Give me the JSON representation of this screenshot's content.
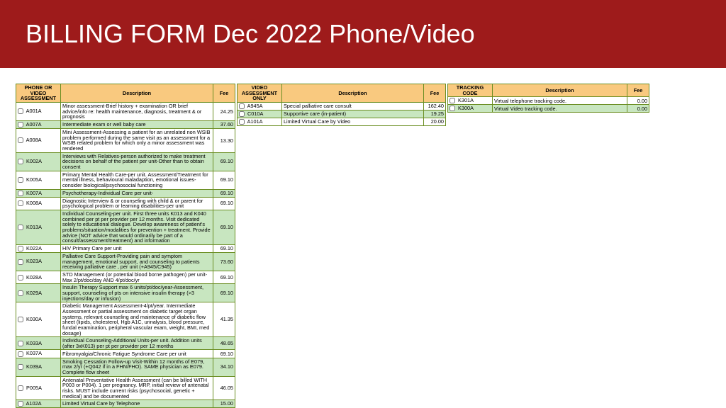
{
  "title": "BILLING FORM Dec 2022 Phone/Video",
  "tables": [
    {
      "headers": [
        "PHONE OR VIDEO ASSESSMENT",
        "Description",
        "Fee"
      ],
      "rows": [
        {
          "code": "A001A",
          "desc": "Minor assessment-Brief history + examination OR brief advice/info re: health maintenance, diagnosis, treatment & or prognosis",
          "fee": "24.25",
          "alt": false
        },
        {
          "code": "A007A",
          "desc": "Intermediate exam or well baby care",
          "fee": "37.60",
          "alt": true
        },
        {
          "code": "A008A",
          "desc": "Mini Assessment-Assessing a patient for an unrelated non WSIB problem performed during the same visit as an assessment for a WSIB related problem for which only a minor assessment was rendered",
          "fee": "13.30",
          "alt": false
        },
        {
          "code": "K002A",
          "desc": "Interviews with Relatives-person authorized to make treatment decisions on behalf of the patient per unit-Other than to obtain consent",
          "fee": "69.10",
          "alt": true
        },
        {
          "code": "K005A",
          "desc": "Primary Mental Health Care-per unit. Assessment/Treatment for mental illness, behavioural maladaption, emotional issues-consider biological/psychosocial functioning",
          "fee": "69.10",
          "alt": false
        },
        {
          "code": "K007A",
          "desc": "Psychotherapy-Individual Care per unit-",
          "fee": "69.10",
          "alt": true
        },
        {
          "code": "K008A",
          "desc": "Diagnostic Interview & or counseling with child & or parent for psychological problem or learning disabilities-per unit",
          "fee": "69.10",
          "alt": false
        },
        {
          "code": "K013A",
          "desc": "Individual Counseling-per unit. First three units K013 and K040 combined per pt per provider per 12 months. Visit dedicated solely to educational dialogue. Develop awareness of patient's problems/situation/modalities for prevention + treatment. Provide advice (NOT advice that would ordinarily be part of a consult/assessment/treatment) and information",
          "fee": "69.10",
          "alt": true
        },
        {
          "code": "K022A",
          "desc": "HIV Primary Care per unit",
          "fee": "69.10",
          "alt": false
        },
        {
          "code": "K023A",
          "desc": "Palliative Care Support-Providing pain and symptom management, emotional support, and counseling to patients receiving palliative care , per unit (+A945/C945)",
          "fee": "73.60",
          "alt": true
        },
        {
          "code": "K028A",
          "desc": "STD Management (or potential blood borne pathogen) per unit-Max 2/pt/doc/day AND 4/pt/doc/yr",
          "fee": "69.10",
          "alt": false
        },
        {
          "code": "K029A",
          "desc": "Insulin Therapy Support max 6 units/pt/doc/year-Assessment, support, counseling of pts on intensive insulin therapy (>3 injections/day or infusion)",
          "fee": "69.10",
          "alt": true
        },
        {
          "code": "K030A",
          "desc": "Diabetic Management Assessment-4/pt/year. Intermediate Assessment or partial assessment on diabetic target organ systems, relevant counseling and maintenance of diabetic flow sheet (lipids, cholesterol, Hgb A1C, urinalysis, blood pressure, fundal examination, peripheral vascular exam, weight, BMI, med dosage)",
          "fee": "41.35",
          "alt": false
        },
        {
          "code": "K033A",
          "desc": "Individual Counseling-Additional Units-per unit. Addition units (after 3xK013) per pt per provider per 12 months",
          "fee": "48.65",
          "alt": true
        },
        {
          "code": "K037A",
          "desc": "Fibromyalgia/Chronic Fatigue Syndrome Care per unit",
          "fee": "69.10",
          "alt": false
        },
        {
          "code": "K039A",
          "desc": "Smoking Cessation Follow-up Visit-Within 12 months of E079, max 2/yr (+Q042 if in a FHN/FHO). SAME physician as E079. Complete flow sheet",
          "fee": "34.10",
          "alt": true
        },
        {
          "code": "P005A",
          "desc": "Antenatal Preventative Health Assessment (can be billed WITH P003 or P004). 1 per pregnancy. MRP, initial review of antenatal risks. MUST include current risks (psychosocial, genetic + medical) and be documented",
          "fee": "46.05",
          "alt": false
        },
        {
          "code": "A102A",
          "desc": "Limited Virtual Care by Telephone",
          "fee": "15.00",
          "alt": true
        }
      ]
    },
    {
      "headers": [
        "VIDEO ASSESSMENT ONLY",
        "Description",
        "Fee"
      ],
      "rows": [
        {
          "code": "A945A",
          "desc": "Special palliative care consult",
          "fee": "162.40",
          "alt": false
        },
        {
          "code": "C010A",
          "desc": "Supportive care (in-patient)",
          "fee": "19.25",
          "alt": true
        },
        {
          "code": "A101A",
          "desc": "Limited Virtual Care by Video",
          "fee": "20.00",
          "alt": false
        }
      ]
    },
    {
      "headers": [
        "TRACKING CODE",
        "Description",
        "Fee"
      ],
      "rows": [
        {
          "code": "K301A",
          "desc": "Virtual telephone tracking code.",
          "fee": "0.00",
          "alt": false
        },
        {
          "code": "K300A",
          "desc": "Virtual Video tracking code.",
          "fee": "0.00",
          "alt": true
        }
      ]
    }
  ]
}
